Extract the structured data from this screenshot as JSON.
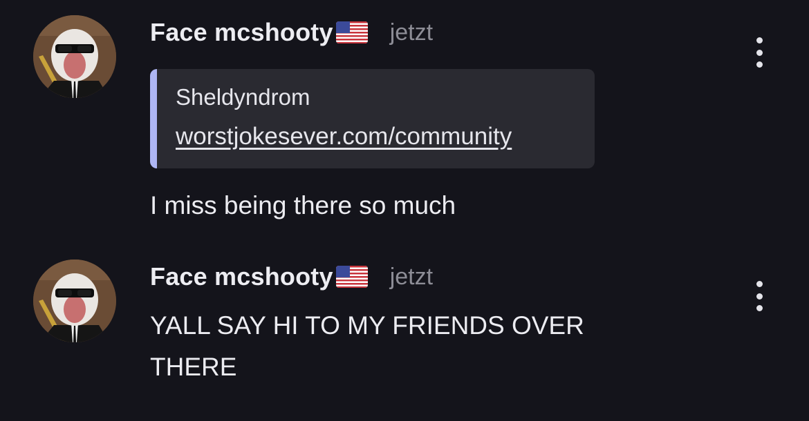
{
  "messages": [
    {
      "author": "Face mcshooty",
      "time": "jetzt",
      "embed": {
        "title": "Sheldyndrom",
        "link": "worstjokesever.com/community"
      },
      "text": "I miss being there so much"
    },
    {
      "author": "Face mcshooty",
      "time": "jetzt",
      "text_line1": "YALL SAY HI TO MY FRIENDS OVER",
      "text_line2": "THERE"
    }
  ],
  "colors": {
    "background": "#14141b",
    "embed_background": "#2a2a31",
    "embed_accent": "#aeb6f4",
    "timestamp": "#8d8d96"
  },
  "icons": [
    "avatar-image",
    "us-flag-icon",
    "more-options-icon"
  ]
}
